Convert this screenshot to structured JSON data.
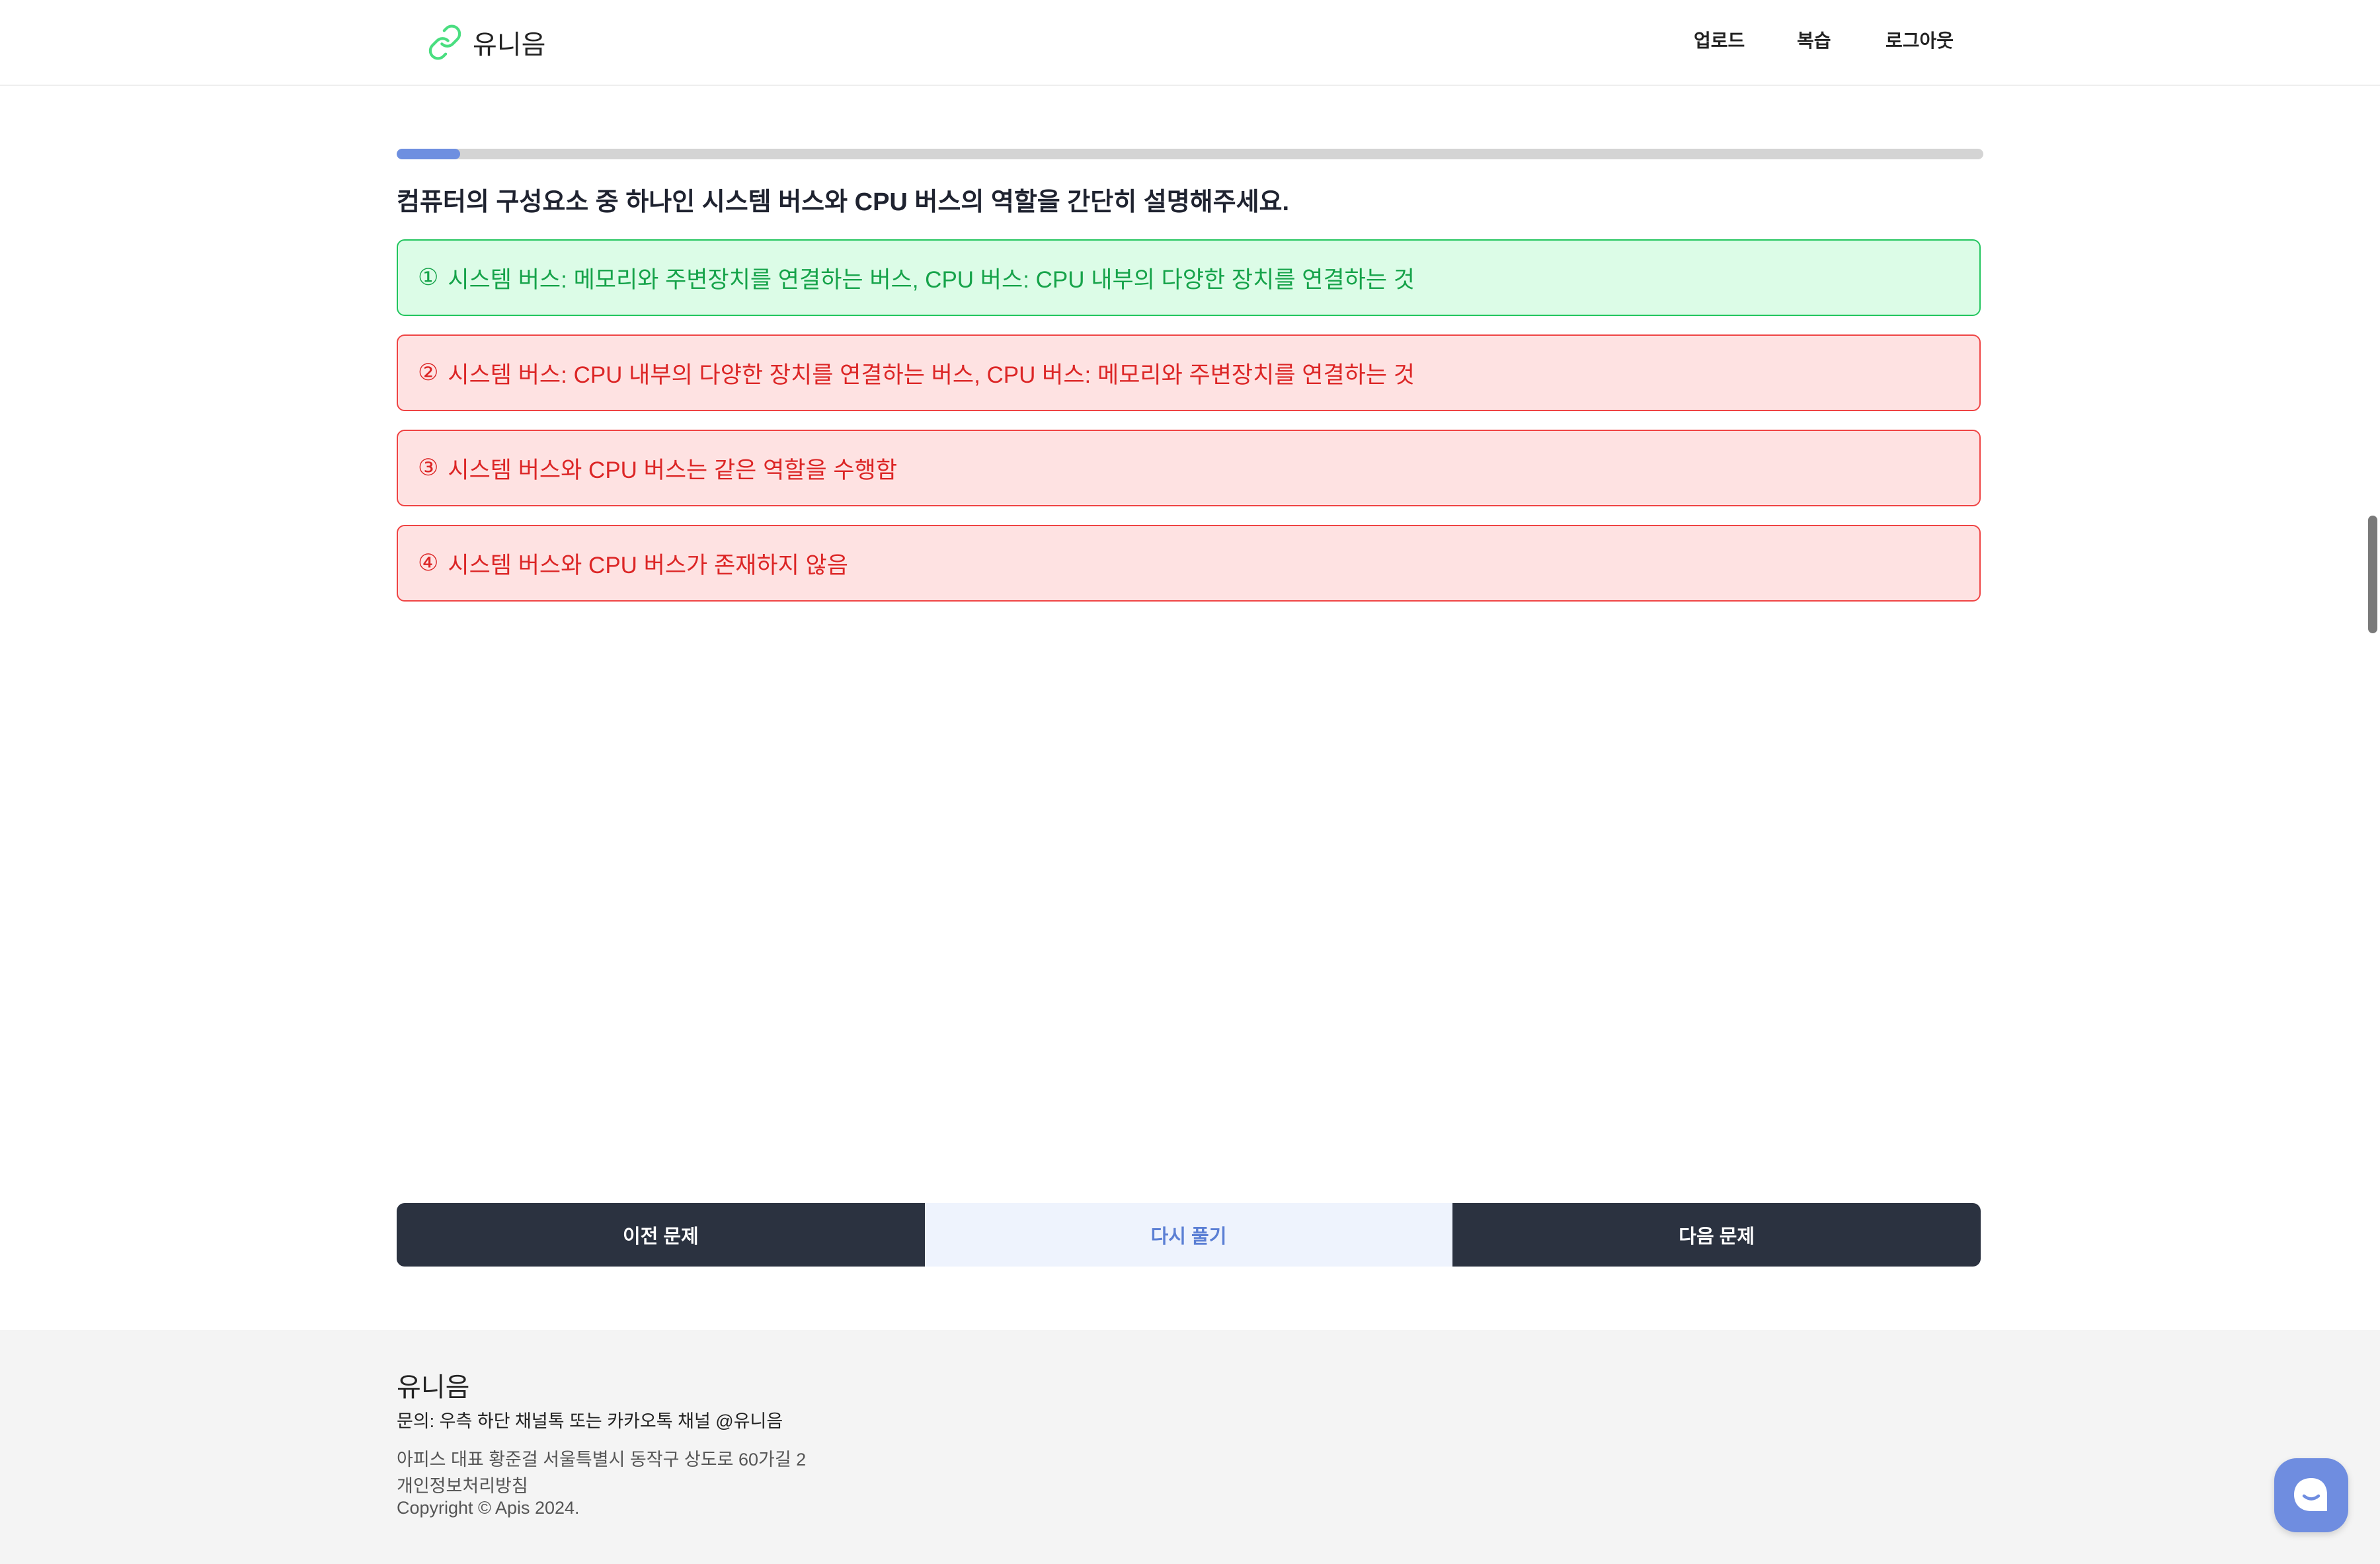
{
  "header": {
    "brand": "유니음",
    "nav": [
      "업로드",
      "복습",
      "로그아웃"
    ]
  },
  "quiz": {
    "progress_fraction": 0.04,
    "question": "컴퓨터의 구성요소 중 하나인 시스템 버스와 CPU 버스의 역할을 간단히 설명해주세요.",
    "options": [
      {
        "num": "①",
        "text": "시스템 버스: 메모리와 주변장치를 연결하는 버스, CPU 버스: CPU 내부의 다양한 장치를 연결하는 것",
        "state": "correct"
      },
      {
        "num": "②",
        "text": "시스템 버스: CPU 내부의 다양한 장치를 연결하는 버스, CPU 버스: 메모리와 주변장치를 연결하는 것",
        "state": "wrong"
      },
      {
        "num": "③",
        "text": "시스템 버스와 CPU 버스는 같은 역할을 수행함",
        "state": "wrong"
      },
      {
        "num": "④",
        "text": "시스템 버스와 CPU 버스가 존재하지 않음",
        "state": "wrong"
      }
    ]
  },
  "buttons": {
    "prev": "이전 문제",
    "retry": "다시 풀기",
    "next": "다음 문제"
  },
  "footer": {
    "title": "유니음",
    "contact": "문의: 우측 하단 채널톡 또는 카카오톡 채널 @유니음",
    "address": "아피스 대표 황준걸 서울특별시 동작구 상도로 60가길 2",
    "privacy": "개인정보처리방침",
    "copyright": "Copyright © Apis 2024."
  },
  "colors": {
    "accent": "#6e8fe0",
    "correct_bg": "#dcfce7",
    "correct_border": "#22c55e",
    "wrong_bg": "#fee2e2",
    "wrong_border": "#ef4444",
    "dark_button": "#2b3240"
  },
  "icons": {
    "logo": "link-icon",
    "chat": "chat-bubble-icon"
  }
}
